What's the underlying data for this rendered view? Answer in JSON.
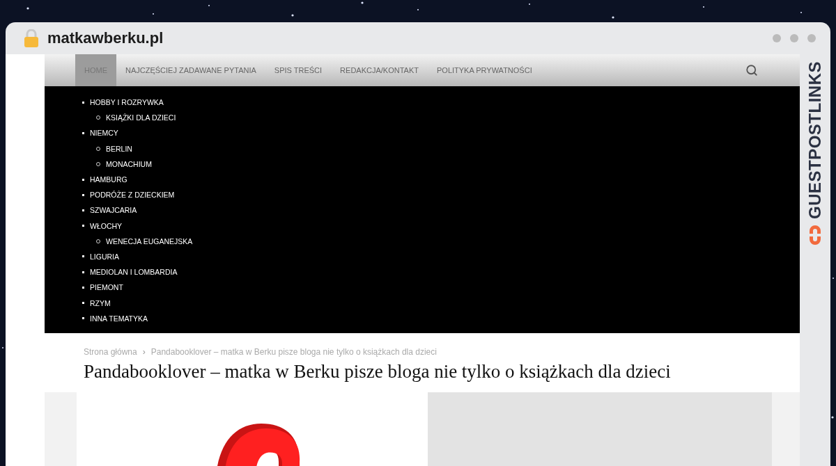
{
  "browser": {
    "address": "matkawberku.pl"
  },
  "brand": {
    "logo_text": "GUESTPOSTLINKS"
  },
  "nav": {
    "items": [
      {
        "label": "HOME",
        "selected": true
      },
      {
        "label": "NAJCZĘŚCIEJ ZADAWANE PYTANIA",
        "selected": false
      },
      {
        "label": "SPIS TREŚCI",
        "selected": false
      },
      {
        "label": "REDAKCJA/KONTAKT",
        "selected": false
      },
      {
        "label": "POLITYKA PRYWATNOŚCI",
        "selected": false
      }
    ]
  },
  "menu": [
    {
      "label": "HOBBY I ROZRYWKA",
      "children": [
        {
          "label": "KSIĄŻKI DLA DZIECI"
        }
      ]
    },
    {
      "label": "NIEMCY",
      "children": [
        {
          "label": "BERLIN"
        },
        {
          "label": "MONACHIUM"
        }
      ]
    },
    {
      "label": "HAMBURG"
    },
    {
      "label": "PODRÓŻE Z DZIECKIEM"
    },
    {
      "label": "SZWAJCARIA"
    },
    {
      "label": "WŁOCHY",
      "children": [
        {
          "label": "WENECJA EUGANEJSKA"
        }
      ]
    },
    {
      "label": "LIGURIA"
    },
    {
      "label": "MEDIOLAN I LOMBARDIA"
    },
    {
      "label": "PIEMONT"
    },
    {
      "label": "RZYM"
    },
    {
      "label": "INNA TEMATYKA"
    }
  ],
  "breadcrumb": {
    "separator": "›",
    "items": [
      "Strona główna",
      "Pandabooklover – matka w Berku pisze bloga nie tylko o książkach dla dzieci"
    ]
  },
  "article": {
    "title": "Pandabooklover – matka w Berku pisze bloga nie tylko o książkach dla dzieci"
  }
}
